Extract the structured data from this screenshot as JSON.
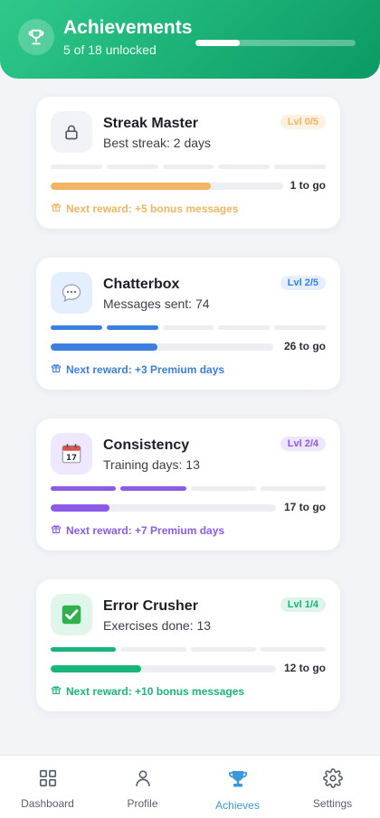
{
  "header": {
    "title": "Achievements",
    "subtitle": "5 of 18 unlocked",
    "unlocked": 5,
    "total": 18
  },
  "cards": [
    {
      "title": "Streak Master",
      "subtitle": "Best streak: 2 days",
      "level": "Lvl 0/5",
      "levels_done": 0,
      "levels_total": 5,
      "progress": 0.69,
      "to_go": "1 to go",
      "reward": "Next reward: +5 bonus messages",
      "icon": "lock-icon",
      "accent": "#f2b562",
      "icon_bg": "#f2f3f6",
      "badge_bg": "#fdf1e2"
    },
    {
      "title": "Chatterbox",
      "subtitle": "Messages sent: 74",
      "level": "Lvl 2/5",
      "levels_done": 2,
      "levels_total": 5,
      "progress": 0.48,
      "to_go": "26 to go",
      "reward": "Next reward: +3 Premium days",
      "icon": "speech-bubble-icon",
      "accent": "#3b7fe0",
      "icon_bg": "#e3efff",
      "badge_bg": "#e5efff"
    },
    {
      "title": "Consistency",
      "subtitle": "Training days: 13",
      "level": "Lvl 2/4",
      "levels_done": 2,
      "levels_total": 4,
      "progress": 0.26,
      "to_go": "17 to go",
      "reward": "Next reward: +7 Premium days",
      "icon": "calendar-icon",
      "accent": "#8b5be8",
      "icon_bg": "#efe7fd",
      "badge_bg": "#efe6fd"
    },
    {
      "title": "Error Crusher",
      "subtitle": "Exercises done: 13",
      "level": "Lvl 1/4",
      "levels_done": 1,
      "levels_total": 4,
      "progress": 0.4,
      "to_go": "12 to go",
      "reward": "Next reward: +10 bonus messages",
      "icon": "check-mark-icon",
      "accent": "#19b57a",
      "icon_bg": "#e0f6ec",
      "badge_bg": "#dff5ea"
    }
  ],
  "nav": [
    {
      "label": "Dashboard",
      "icon": "grid-icon",
      "active": false
    },
    {
      "label": "Profile",
      "icon": "person-icon",
      "active": false
    },
    {
      "label": "Achieves",
      "icon": "trophy-icon",
      "active": true
    },
    {
      "label": "Settings",
      "icon": "gear-icon",
      "active": false
    }
  ],
  "colors": {
    "header_start": "#2fc98b",
    "header_end": "#0a9a64",
    "nav_active": "#3a9ad9",
    "nav_inactive": "#5a5f6a"
  }
}
